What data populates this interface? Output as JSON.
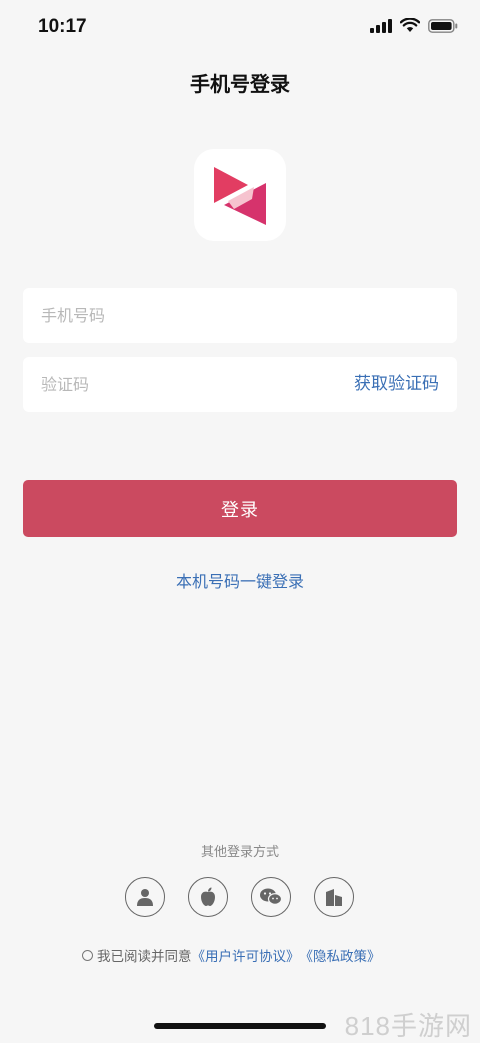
{
  "status": {
    "time": "10:17"
  },
  "page": {
    "title": "手机号登录"
  },
  "form": {
    "phone_placeholder": "手机号码",
    "code_placeholder": "验证码",
    "get_code_label": "获取验证码",
    "login_label": "登录",
    "one_click_label": "本机号码一键登录"
  },
  "other_login": {
    "title": "其他登录方式",
    "options": [
      "account-icon",
      "apple-icon",
      "wechat-icon",
      "building-icon"
    ]
  },
  "agreement": {
    "prefix": "我已阅读并同意",
    "user_license": "《用户许可协议》",
    "privacy_policy": "《隐私政策》"
  },
  "watermark": "818手游网",
  "colors": {
    "accent": "#cb4a60",
    "link": "#3a6fb5",
    "background": "#f6f6f6"
  }
}
